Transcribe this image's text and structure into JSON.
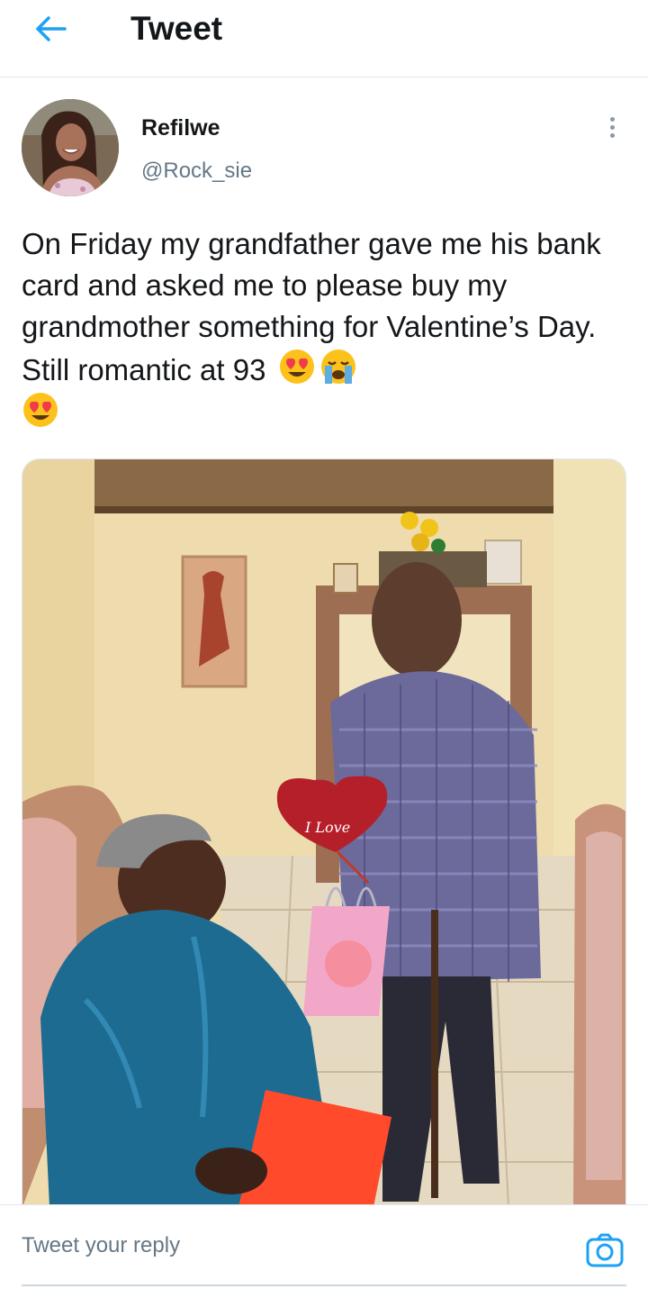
{
  "header": {
    "title": "Tweet",
    "back_icon": "arrow-left-icon",
    "accent": "#1da1f2"
  },
  "tweet": {
    "author_name": "Refilwe",
    "author_handle": "@Rock_sie",
    "text": "On Friday my grandfather gave me his bank card and asked me to please buy my grandmother something for Valentine’s Day. Still romantic at 93",
    "emojis": [
      "smiling-face-with-heart-eyes",
      "loudly-crying-face",
      "smiling-face-with-heart-eyes"
    ],
    "more_icon": "more-vertical-icon",
    "balloon_text": "I Love"
  },
  "reply": {
    "placeholder": "Tweet your reply",
    "camera_icon": "camera-icon"
  }
}
